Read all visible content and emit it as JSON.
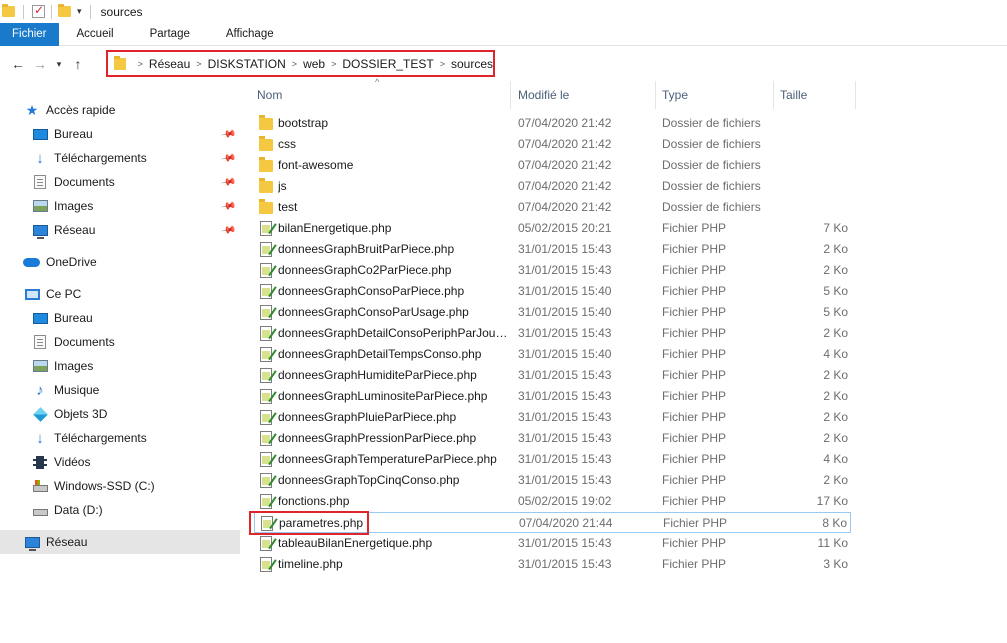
{
  "window": {
    "title": "sources"
  },
  "ribbon": {
    "tabs": [
      "Fichier",
      "Accueil",
      "Partage",
      "Affichage"
    ]
  },
  "colors": {
    "accent": "#1979ca",
    "annotation_red": "#e0242b",
    "folder_yellow": "#f5c842"
  },
  "address": {
    "crumbs": [
      "Réseau",
      "DISKSTATION",
      "web",
      "DOSSIER_TEST",
      "sources"
    ]
  },
  "sidebar": {
    "items": [
      {
        "label": "Accès rapide",
        "icon": "star-icon"
      },
      {
        "label": "Bureau",
        "icon": "desktop-icon",
        "pinned": true
      },
      {
        "label": "Téléchargements",
        "icon": "download-icon",
        "pinned": true
      },
      {
        "label": "Documents",
        "icon": "document-icon",
        "pinned": true
      },
      {
        "label": "Images",
        "icon": "image-icon",
        "pinned": true
      },
      {
        "label": "Réseau",
        "icon": "network-icon",
        "pinned": true
      },
      {
        "label": "OneDrive",
        "icon": "cloud-icon"
      },
      {
        "label": "Ce PC",
        "icon": "computer-icon"
      },
      {
        "label": "Bureau",
        "icon": "desktop-icon"
      },
      {
        "label": "Documents",
        "icon": "document-icon"
      },
      {
        "label": "Images",
        "icon": "image-icon"
      },
      {
        "label": "Musique",
        "icon": "music-icon"
      },
      {
        "label": "Objets 3D",
        "icon": "3d-objects-icon"
      },
      {
        "label": "Téléchargements",
        "icon": "download-icon"
      },
      {
        "label": "Vidéos",
        "icon": "video-icon"
      },
      {
        "label": "Windows-SSD (C:)",
        "icon": "drive-c-icon"
      },
      {
        "label": "Data (D:)",
        "icon": "drive-icon"
      },
      {
        "label": "Réseau",
        "icon": "network-icon",
        "selected": true
      }
    ]
  },
  "filelist": {
    "columns": [
      "Nom",
      "Modifié le",
      "Type",
      "Taille"
    ],
    "rows": [
      {
        "name": "bootstrap",
        "date": "07/04/2020 21:42",
        "type": "Dossier de fichiers",
        "size": "",
        "kind": "folder"
      },
      {
        "name": "css",
        "date": "07/04/2020 21:42",
        "type": "Dossier de fichiers",
        "size": "",
        "kind": "folder"
      },
      {
        "name": "font-awesome",
        "date": "07/04/2020 21:42",
        "type": "Dossier de fichiers",
        "size": "",
        "kind": "folder"
      },
      {
        "name": "js",
        "date": "07/04/2020 21:42",
        "type": "Dossier de fichiers",
        "size": "",
        "kind": "folder"
      },
      {
        "name": "test",
        "date": "07/04/2020 21:42",
        "type": "Dossier de fichiers",
        "size": "",
        "kind": "folder"
      },
      {
        "name": "bilanEnergetique.php",
        "date": "05/02/2015 20:21",
        "type": "Fichier PHP",
        "size": "7 Ko",
        "kind": "php"
      },
      {
        "name": "donneesGraphBruitParPiece.php",
        "date": "31/01/2015 15:43",
        "type": "Fichier PHP",
        "size": "2 Ko",
        "kind": "php"
      },
      {
        "name": "donneesGraphCo2ParPiece.php",
        "date": "31/01/2015 15:43",
        "type": "Fichier PHP",
        "size": "2 Ko",
        "kind": "php"
      },
      {
        "name": "donneesGraphConsoParPiece.php",
        "date": "31/01/2015 15:40",
        "type": "Fichier PHP",
        "size": "5 Ko",
        "kind": "php"
      },
      {
        "name": "donneesGraphConsoParUsage.php",
        "date": "31/01/2015 15:40",
        "type": "Fichier PHP",
        "size": "5 Ko",
        "kind": "php"
      },
      {
        "name": "donneesGraphDetailConsoPeriphParJour....",
        "date": "31/01/2015 15:43",
        "type": "Fichier PHP",
        "size": "2 Ko",
        "kind": "php"
      },
      {
        "name": "donneesGraphDetailTempsConso.php",
        "date": "31/01/2015 15:40",
        "type": "Fichier PHP",
        "size": "4 Ko",
        "kind": "php"
      },
      {
        "name": "donneesGraphHumiditeParPiece.php",
        "date": "31/01/2015 15:43",
        "type": "Fichier PHP",
        "size": "2 Ko",
        "kind": "php"
      },
      {
        "name": "donneesGraphLuminositeParPiece.php",
        "date": "31/01/2015 15:43",
        "type": "Fichier PHP",
        "size": "2 Ko",
        "kind": "php"
      },
      {
        "name": "donneesGraphPluieParPiece.php",
        "date": "31/01/2015 15:43",
        "type": "Fichier PHP",
        "size": "2 Ko",
        "kind": "php"
      },
      {
        "name": "donneesGraphPressionParPiece.php",
        "date": "31/01/2015 15:43",
        "type": "Fichier PHP",
        "size": "2 Ko",
        "kind": "php"
      },
      {
        "name": "donneesGraphTemperatureParPiece.php",
        "date": "31/01/2015 15:43",
        "type": "Fichier PHP",
        "size": "4 Ko",
        "kind": "php"
      },
      {
        "name": "donneesGraphTopCinqConso.php",
        "date": "31/01/2015 15:43",
        "type": "Fichier PHP",
        "size": "2 Ko",
        "kind": "php"
      },
      {
        "name": "fonctions.php",
        "date": "05/02/2015 19:02",
        "type": "Fichier PHP",
        "size": "17 Ko",
        "kind": "php"
      },
      {
        "name": "parametres.php",
        "date": "07/04/2020 21:44",
        "type": "Fichier PHP",
        "size": "8 Ko",
        "kind": "php",
        "highlighted": true
      },
      {
        "name": "tableauBilanEnergetique.php",
        "date": "31/01/2015 15:43",
        "type": "Fichier PHP",
        "size": "11 Ko",
        "kind": "php"
      },
      {
        "name": "timeline.php",
        "date": "31/01/2015 15:43",
        "type": "Fichier PHP",
        "size": "3 Ko",
        "kind": "php"
      }
    ]
  }
}
